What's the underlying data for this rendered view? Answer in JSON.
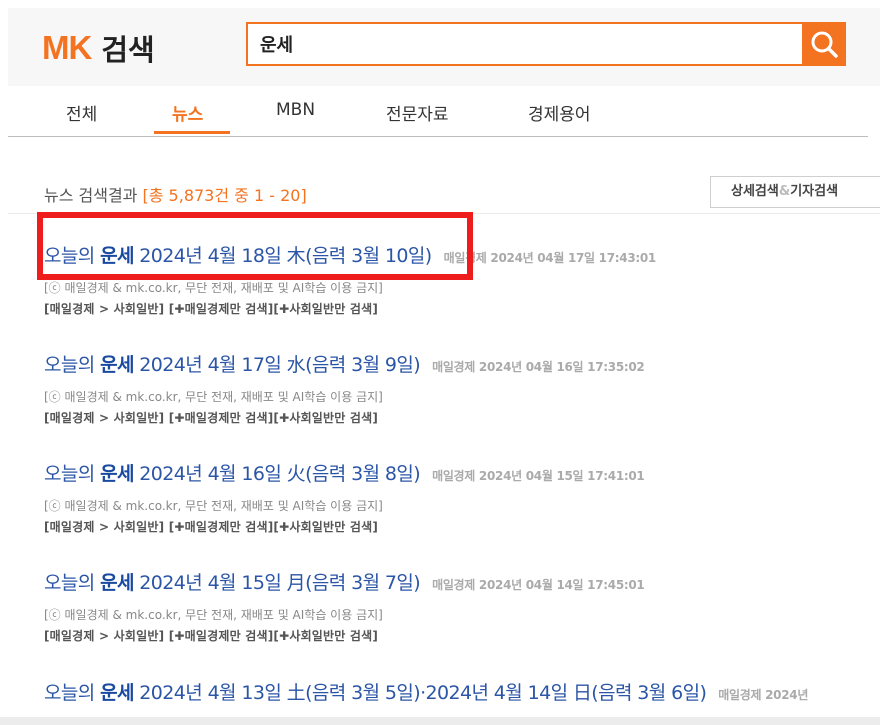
{
  "header": {
    "logo_mk": "MK",
    "logo_search": "검색",
    "search_value": "운세",
    "search_icon": "magnifier-icon",
    "accent": "#f37321"
  },
  "tabs": [
    {
      "label": "전체"
    },
    {
      "label": "뉴스"
    },
    {
      "label": "MBN"
    },
    {
      "label": "전문자료"
    },
    {
      "label": "경제용어"
    }
  ],
  "results": {
    "head_label": "뉴스 검색결과",
    "count_text": "[총 5,873건 중 1 - 20]",
    "detail_button": {
      "main": "상세검색",
      "amp": "&",
      "sub": "기자검색"
    }
  },
  "items": [
    {
      "title_pre": "오늘의 ",
      "title_key": "운세",
      "title_post": " 2024년 4월 18일 木(음력 3월 10일)",
      "meta": "매일경제 2024년 04월 17일 17:43:01",
      "desc": "[ⓒ 매일경제 & mk.co.kr, 무단 전재, 재배포 및 AI학습 이용 금지]",
      "cat_path": "[매일경제 > 사회일반]",
      "cat_source": "[✚매일경제만 검색]",
      "cat_section": "[✚사회일반만 검색]"
    },
    {
      "title_pre": "오늘의 ",
      "title_key": "운세",
      "title_post": " 2024년 4월 17일 水(음력 3월 9일)",
      "meta": "매일경제 2024년 04월 16일 17:35:02",
      "desc": "[ⓒ 매일경제 & mk.co.kr, 무단 전재, 재배포 및 AI학습 이용 금지]",
      "cat_path": "[매일경제 > 사회일반]",
      "cat_source": "[✚매일경제만 검색]",
      "cat_section": "[✚사회일반만 검색]"
    },
    {
      "title_pre": "오늘의 ",
      "title_key": "운세",
      "title_post": " 2024년 4월 16일 火(음력 3월 8일)",
      "meta": "매일경제 2024년 04월 15일 17:41:01",
      "desc": "[ⓒ 매일경제 & mk.co.kr, 무단 전재, 재배포 및 AI학습 이용 금지]",
      "cat_path": "[매일경제 > 사회일반]",
      "cat_source": "[✚매일경제만 검색]",
      "cat_section": "[✚사회일반만 검색]"
    },
    {
      "title_pre": "오늘의 ",
      "title_key": "운세",
      "title_post": " 2024년 4월 15일 月(음력 3월 7일)",
      "meta": "매일경제 2024년 04월 14일 17:45:01",
      "desc": "[ⓒ 매일경제 & mk.co.kr, 무단 전재, 재배포 및 AI학습 이용 금지]",
      "cat_path": "[매일경제 > 사회일반]",
      "cat_source": "[✚매일경제만 검색]",
      "cat_section": "[✚사회일반만 검색]"
    },
    {
      "title_pre": "오늘의 ",
      "title_key": "운세",
      "title_post": " 2024년 4월 13일 土(음력 3월 5일)·2024년 4월 14일 日(음력 3월 6일)",
      "meta": "매일경제 2024년"
    }
  ]
}
